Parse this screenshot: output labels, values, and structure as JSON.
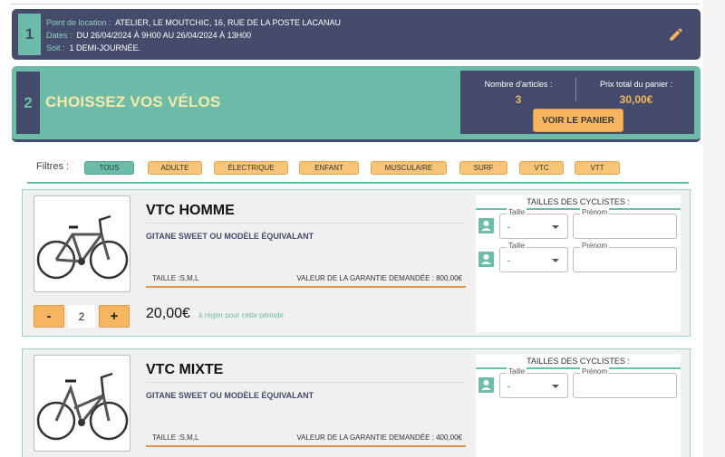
{
  "step1": {
    "number": "1",
    "location_label": "Point de location :",
    "location_value": "ATELIER, LE MOUTCHIC, 16, RUE DE LA POSTE LACANAU",
    "dates_label": "Dates :",
    "dates_value": "DU 26/04/2024 À 9H00 AU 26/04/2024 À 13H00",
    "duration_label": "Soit :",
    "duration_value": "1 DEMI-JOURNÉE.",
    "edit_icon": "pencil-icon"
  },
  "step2": {
    "number": "2",
    "title": "CHOISSEZ VOS VÉLOS",
    "articles_label": "Nombre d'articles :",
    "articles_value": "3",
    "total_label": "Prix total du panier :",
    "total_value": "30,00€",
    "cart_button": "VOIR LE PANIER"
  },
  "filters": {
    "label": "Filtres :",
    "chips": [
      "TOUS",
      "ADULTE",
      "ÉLECTRIQUE",
      "ENFANT",
      "MUSCULAIRE",
      "SURF",
      "VTC",
      "VTT"
    ],
    "active": "TOUS"
  },
  "products": [
    {
      "name": "VTC HOMME",
      "subtitle": "GITANE SWEET OU MODÈLE ÉQUIVALANT",
      "sizes": "TAILLE :S,M,L",
      "deposit": "VALEUR DE LA GARANTIE DEMANDÉE : 800,00€",
      "quantity": "2",
      "minus": "-",
      "plus": "+",
      "price": "20,00€",
      "price_note": "à régler pour cette période",
      "riders_title": "TAILLES DES CYCLISTES :",
      "riders": [
        {
          "size_label": "Taille",
          "size_value": "-",
          "name_label": "Prénom",
          "name_value": ""
        },
        {
          "size_label": "Taille",
          "size_value": "-",
          "name_label": "Prénom",
          "name_value": ""
        }
      ]
    },
    {
      "name": "VTC MIXTE",
      "subtitle": "GITANE SWEET OU MODÈLE ÉQUIVALANT",
      "sizes": "TAILLE :S,M,L",
      "deposit": "VALEUR DE LA GARANTIE DEMANDÉE : 400,00€",
      "riders_title": "TAILLES DES CYCLISTES :",
      "riders": [
        {
          "size_label": "Taille",
          "size_value": "-",
          "name_label": "Prénom",
          "name_value": ""
        }
      ]
    }
  ],
  "colors": {
    "navy": "#454c6b",
    "teal": "#6dbcaa",
    "orange": "#f6b55f",
    "yellow_title": "#f5e9a8"
  }
}
